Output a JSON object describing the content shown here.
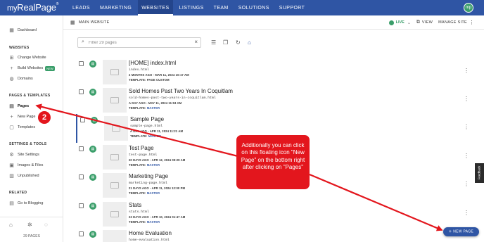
{
  "brand": {
    "prefix": "my",
    "name": "RealPage",
    "tm": "®"
  },
  "nav": [
    "LEADS",
    "MARKETING",
    "WEBSITES",
    "LISTINGS",
    "TEAM",
    "SOLUTIONS",
    "SUPPORT"
  ],
  "user": {
    "initials": "mp"
  },
  "sidebar": {
    "dashboard": "Dashboard",
    "websites_head": "WEBSITES",
    "change_website": "Change Website",
    "build_websites": "Build Websites",
    "new_badge": "NEW",
    "domains": "Domains",
    "pages_head": "PAGES & TEMPLATES",
    "pages": "Pages",
    "new_page": "New Page",
    "templates": "Templates",
    "settings_head": "SETTINGS & TOOLS",
    "site_settings": "Site Settings",
    "images_files": "Images & Files",
    "unpublished": "Unpublished",
    "related_head": "RELATED",
    "go_blogging": "Go to Blogging",
    "count": "29 PAGES"
  },
  "header": {
    "title": "MAIN WEBSITE",
    "live": "LIVE",
    "view": "VIEW",
    "manage": "MANAGE SITE"
  },
  "search": {
    "placeholder": "Filter 29 pages"
  },
  "pages": [
    {
      "title": "[HOME] index.html",
      "file": "index.html",
      "meta": "2 MONTHS AGO - MAR 11, 2024 10:17 AM",
      "template_label": "TEMPLATE:",
      "template": "PAGE CUSTOM"
    },
    {
      "title": "Sold Homes Past Two Years In Coquitlam",
      "file": "sold-homes-past-two-years-in-coquitlam.html",
      "meta": "A DAY AGO - MAY 11, 2024 11:53 AM",
      "template_label": "TEMPLATE:",
      "template": "MASTER"
    },
    {
      "title": "Sample Page",
      "file": "sample-page.html",
      "meta": "A DAY AGO - APR 11, 2024 11:21 AM",
      "template_label": "TEMPLATE:",
      "template": "MASTER"
    },
    {
      "title": "Test Page",
      "file": "test-page.html",
      "meta": "20 DAYS AGO - APR 12, 2024 09:29 AM",
      "template_label": "TEMPLATE:",
      "template": "MASTER"
    },
    {
      "title": "Marketing Page",
      "file": "marketing-page.html",
      "meta": "21 DAYS AGO - APR 11, 2024 12:00 PM",
      "template_label": "TEMPLATE:",
      "template": "MASTER"
    },
    {
      "title": "Stats",
      "file": "stats.html",
      "meta": "23 DAYS AGO - APR 10, 2024 01:47 AM",
      "template_label": "TEMPLATE:",
      "template": "MASTER"
    },
    {
      "title": "Home Evaluation",
      "file": "home-evaluation.html",
      "meta": "",
      "template_label": "",
      "template": ""
    }
  ],
  "fab": {
    "label": "NEW PAGE"
  },
  "feedback": "Feedback",
  "annotation": {
    "callout": "Additionally you can click on this floating icon \"New Page\" on the bottom right after clicking on \"Pages\"",
    "step": "2",
    "color": "#e3161d"
  },
  "colors": {
    "brand": "#2f55a4",
    "success": "#3a9e6a"
  }
}
